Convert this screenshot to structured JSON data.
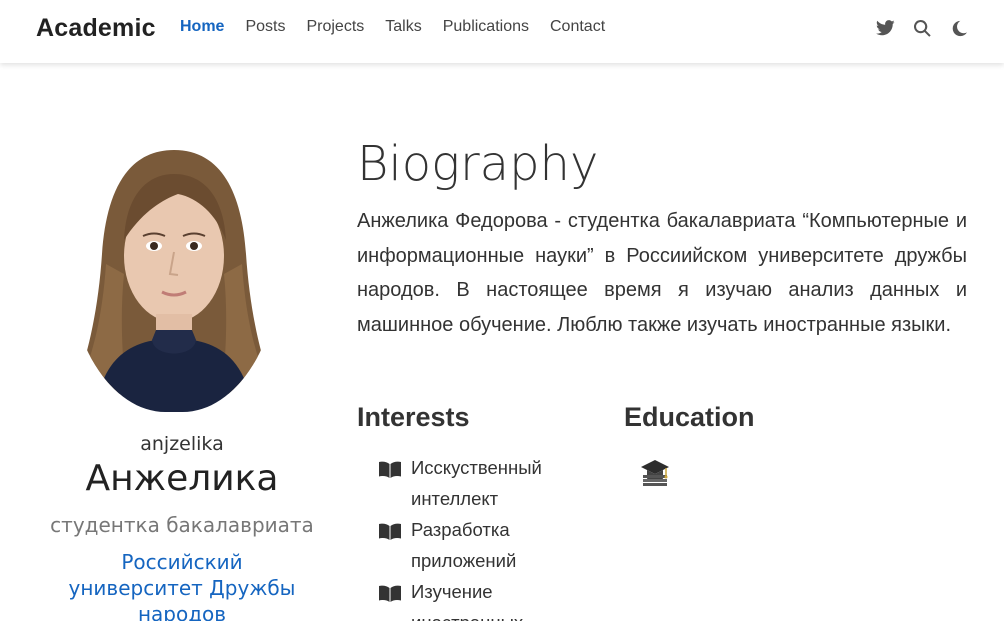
{
  "nav": {
    "brand": "Academic",
    "links": [
      {
        "label": "Home",
        "active": true
      },
      {
        "label": "Posts"
      },
      {
        "label": "Projects"
      },
      {
        "label": "Talks"
      },
      {
        "label": "Publications"
      },
      {
        "label": "Contact"
      }
    ],
    "icons": [
      "twitter-icon",
      "search-icon",
      "moon-icon"
    ],
    "accent_color": "#1565c0"
  },
  "profile": {
    "username": "anjzelika",
    "name": "Анжелика",
    "role": "студентка бакалавриата",
    "organization_lines": [
      "Российский",
      "университет Дружбы",
      "народов"
    ]
  },
  "biography": {
    "title": "Biography",
    "text": "Анжелика Федорова - студентка бакалавриата “Компьютерные и информационные науки” в Россиийском университете дружбы народов. В настоящее время я изучаю анализ данных и машинное обучение. Люблю также изучать иностранные языки."
  },
  "interests": {
    "title": "Interests",
    "items": [
      {
        "lines": [
          "Исскуственный",
          "интеллект"
        ]
      },
      {
        "lines": [
          "Разработка",
          "приложений"
        ]
      },
      {
        "lines": [
          "Изучение",
          "иностранных"
        ]
      }
    ],
    "icon": "book-icon"
  },
  "education": {
    "title": "Education",
    "icon": "graduation-cap-icon"
  }
}
